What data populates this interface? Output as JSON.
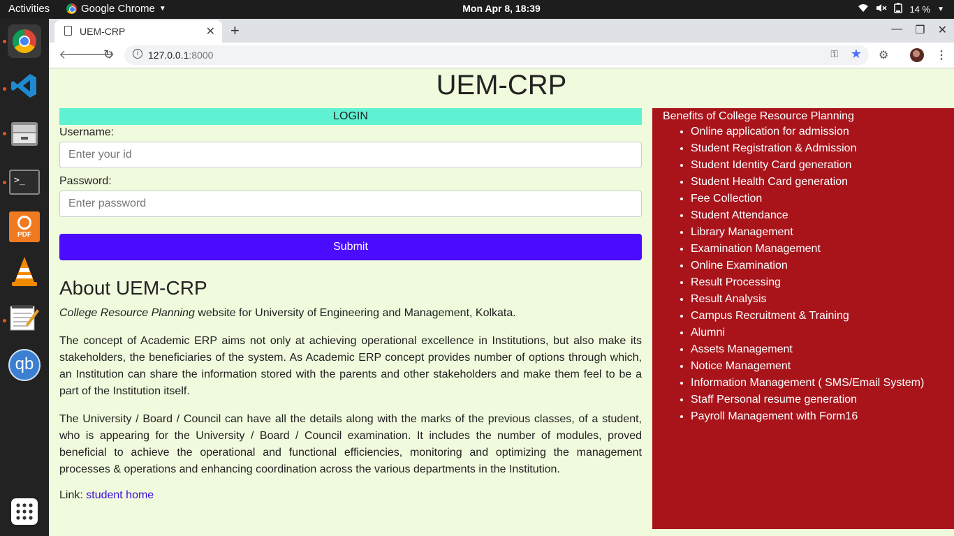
{
  "topbar": {
    "activities": "Activities",
    "app_name": "Google Chrome",
    "clock": "Mon Apr  8, 18:39",
    "battery": "14 %"
  },
  "dock": {
    "items": [
      "chrome",
      "vscode",
      "files",
      "terminal",
      "pdf",
      "vlc",
      "text-editor",
      "qbittorrent",
      "show-apps"
    ]
  },
  "browser": {
    "tab_title": "UEM-CRP",
    "url_host": "127.0.0.1",
    "url_port": ":8000"
  },
  "page": {
    "site_title": "UEM-CRP",
    "login": {
      "header": "LOGIN",
      "username_label": "Username:",
      "username_placeholder": "Enter your id",
      "password_label": "Password:",
      "password_placeholder": "Enter password",
      "submit_label": "Submit"
    },
    "about": {
      "heading": "About UEM-CRP",
      "intro_em": "College Resource Planning",
      "intro_rest": " website for University of Engineering and Management, Kolkata.",
      "para1": "The concept of Academic ERP aims not only at achieving operational excellence in Institutions, but also make its stakeholders, the beneficiaries of the system. As Academic ERP concept provides number of options through which, an Institution can share the information stored with the parents and other stakeholders and make them feel to be a part of the Institution itself.",
      "para2": "The University / Board / Council can have all the details along with the marks of the previous classes, of a student, who is appearing for the University / Board / Council examination. It includes the number of modules, proved beneficial to achieve the operational and functional efficiencies, monitoring and optimizing the management processes & operations and enhancing coordination across the various departments in the Institution.",
      "link_label": "Link: ",
      "link_text": "student home"
    },
    "benefits": {
      "title": "Benefits of College Resource Planning",
      "items": [
        "Online application for admission",
        "Student Registration & Admission",
        "Student Identity Card generation",
        "Student Health Card generation",
        "Fee Collection",
        "Student Attendance",
        "Library Management",
        "Examination Management",
        "Online Examination",
        "Result Processing",
        "Result Analysis",
        "Campus Recruitment & Training",
        "Alumni",
        "Assets Management",
        "Notice Management",
        "Information Management ( SMS/Email System)",
        "Staff Personal resume generation",
        "Payroll Management with Form16"
      ]
    }
  }
}
